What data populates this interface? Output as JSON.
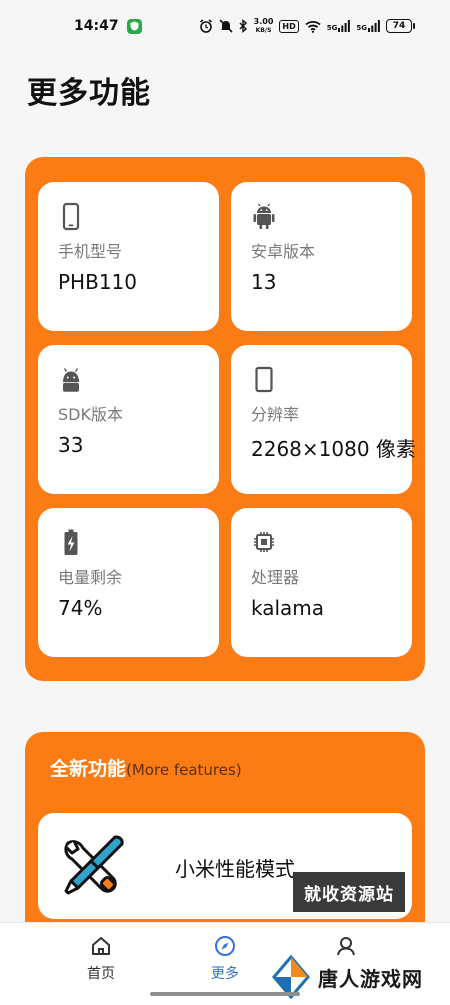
{
  "status_bar": {
    "time": "14:47",
    "speed_value": "3.00",
    "speed_unit": "KB/S",
    "hd": "HD",
    "net1": "5G",
    "net2": "5G",
    "battery": "74"
  },
  "page": {
    "title": "更多功能"
  },
  "info_cards": [
    {
      "icon": "phone-icon",
      "label": "手机型号",
      "value": "PHB110"
    },
    {
      "icon": "android-icon",
      "label": "安卓版本",
      "value": "13"
    },
    {
      "icon": "android-head-icon",
      "label": "SDK版本",
      "value": "33"
    },
    {
      "icon": "screen-icon",
      "label": "分辨率",
      "value": "2268×1080 像素"
    },
    {
      "icon": "battery-charging-icon",
      "label": "电量剩余",
      "value": "74%"
    },
    {
      "icon": "chip-icon",
      "label": "处理器",
      "value": "kalama"
    }
  ],
  "features": {
    "title": "全新功能",
    "subtitle": "(More features)",
    "items": [
      {
        "icon": "tools-icon",
        "label": "小米性能模式"
      }
    ]
  },
  "watermark": {
    "banner": "就收资源站",
    "logo_text": "唐人游戏网"
  },
  "bottom_nav": {
    "items": [
      {
        "icon": "home-icon",
        "label": "首页"
      },
      {
        "icon": "compass-icon",
        "label": "更多",
        "active": true
      },
      {
        "icon": "user-icon",
        "label": ""
      }
    ]
  },
  "colors": {
    "accent": "#fb7b15",
    "active_nav": "#3670d8",
    "card_bg": "#ffffff",
    "page_bg": "#f6f6f6"
  }
}
